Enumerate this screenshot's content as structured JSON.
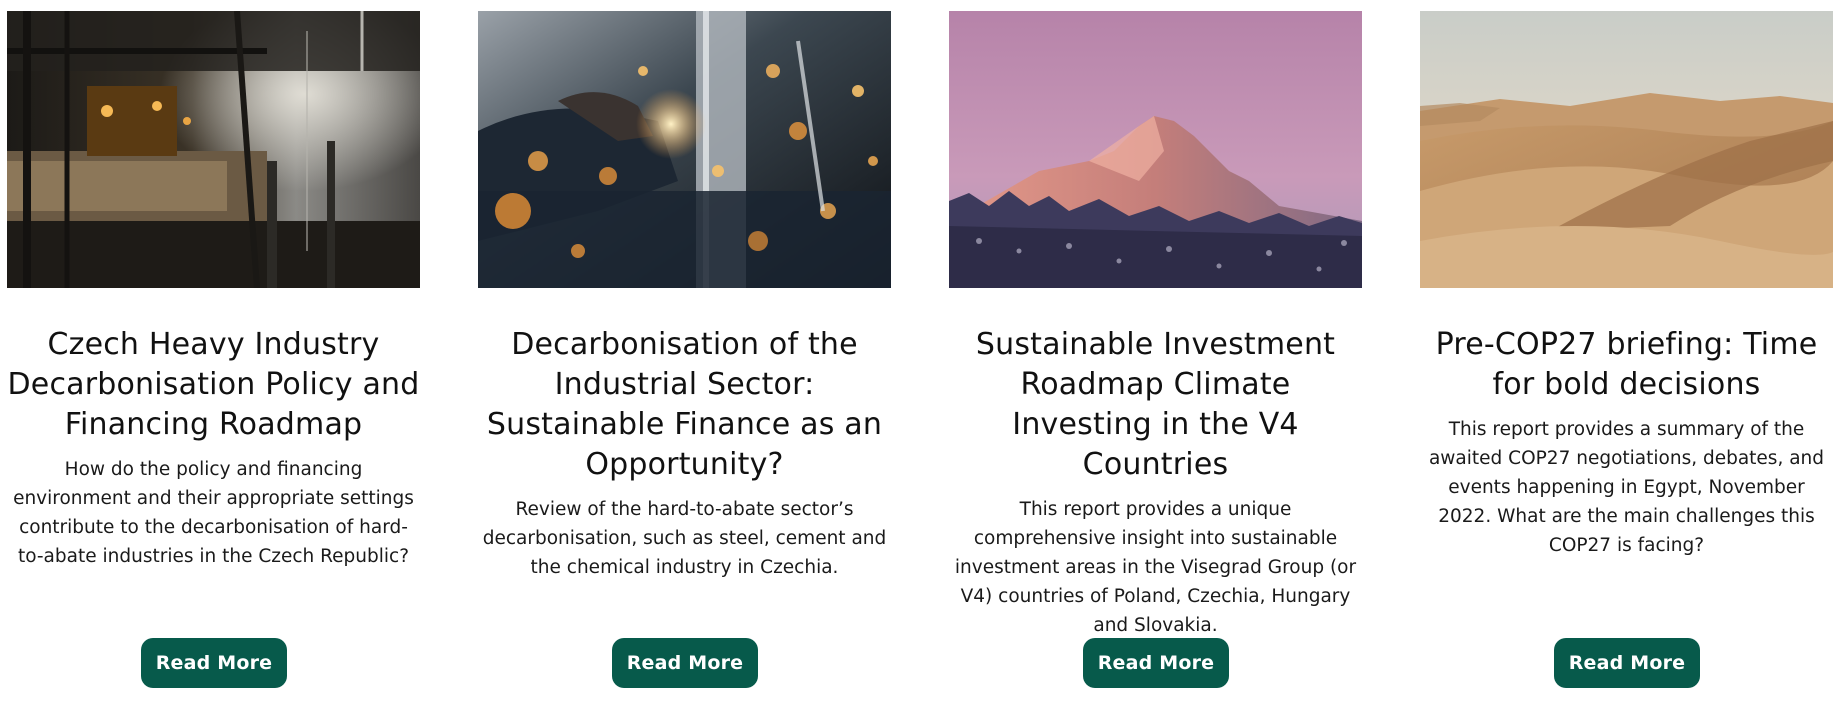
{
  "cards": [
    {
      "title": "Czech Heavy Industry Decarbonisation Policy and Financing Roadmap",
      "description": "How do the policy and financing environment and their appropriate settings contribute to the decarbonisation of hard-to-abate industries in the Czech Republic?",
      "button_label": "Read More",
      "image": "industrial-interior-photo"
    },
    {
      "title": "Decarbonisation of the Industrial Sector: Sustainable Finance as an Opportunity?",
      "description": "Review of the hard-to-abate sector’s decarbonisation, such as steel, cement and the chemical industry in Czechia.",
      "button_label": "Read More",
      "image": "welding-sparks-photo"
    },
    {
      "title": "Sustainable Investment Roadmap Climate Investing in the V4 Countries",
      "description": "This report provides a unique comprehensive insight into sustainable investment areas in the Visegrad Group (or V4) countries of Poland, Czechia, Hungary and Slovakia.",
      "button_label": "Read More",
      "image": "mountain-peak-photo"
    },
    {
      "title": "Pre-COP27 briefing: Time for bold decisions",
      "description": "This report provides a summary of the awaited COP27 negotiations, debates, and events happening in Egypt, November 2022. What are the main challenges this COP27 is facing?",
      "button_label": "Read More",
      "image": "desert-dunes-photo"
    }
  ],
  "colors": {
    "button_bg": "#075a4b",
    "button_text": "#ffffff",
    "title_text": "#111111"
  }
}
